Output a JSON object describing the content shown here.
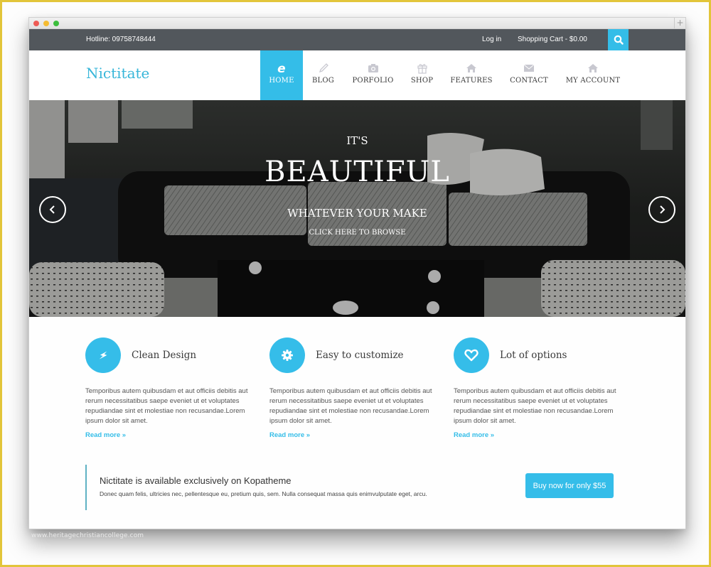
{
  "window": {
    "controls": [
      "close",
      "minimize",
      "maximize"
    ],
    "new_tab_label": "+"
  },
  "topbar": {
    "hotline": "Hotline: 09758748444",
    "login": "Log in",
    "cart": "Shopping Cart - $0.00",
    "search_icon": "search-icon"
  },
  "header": {
    "logo": "Nictitate",
    "nav": [
      {
        "label": "HOME",
        "icon": "ie-icon",
        "active": true
      },
      {
        "label": "BLOG",
        "icon": "pencil-icon",
        "active": false
      },
      {
        "label": "PORFOLIO",
        "icon": "camera-icon",
        "active": false
      },
      {
        "label": "SHOP",
        "icon": "gift-icon",
        "active": false
      },
      {
        "label": "FEATURES",
        "icon": "home-icon",
        "active": false
      },
      {
        "label": "CONTACT",
        "icon": "envelope-icon",
        "active": false
      },
      {
        "label": "MY ACCOUNT",
        "icon": "home-icon",
        "active": false
      }
    ]
  },
  "hero": {
    "line1": "IT'S",
    "line2": "BEAUTIFUL",
    "line3": "WHATEVER YOUR MAKE",
    "cta": "CLICK HERE TO BROWSE",
    "prev": "‹",
    "next": "›"
  },
  "features": [
    {
      "icon": "lightning-icon",
      "title": "Clean Design",
      "body": "Temporibus autem quibusdam et aut officiis debitis aut rerum necessitatibus saepe eveniet ut et voluptates repudiandae sint et molestiae non recusandae.Lorem ipsum dolor sit amet.",
      "link": "Read more »"
    },
    {
      "icon": "gear-icon",
      "title": "Easy to customize",
      "body": "Temporibus autem quibusdam et aut officiis debitis aut rerum necessitatibus saepe eveniet ut et voluptates repudiandae sint et molestiae non recusandae.Lorem ipsum dolor sit amet.",
      "link": "Read more »"
    },
    {
      "icon": "heart-icon",
      "title": "Lot of options",
      "body": "Temporibus autem quibusdam et aut officiis debitis aut rerum necessitatibus saepe eveniet ut et voluptates repudiandae sint et molestiae non recusandae.Lorem ipsum dolor sit amet.",
      "link": "Read more »"
    }
  ],
  "promo": {
    "title": "Nictitate is available exclusively on Kopatheme",
    "body": "Donec quam felis, ultricies nec, pellentesque eu, pretium quis, sem. Nulla consequat massa quis enimvulputate eget, arcu.",
    "button": "Buy now for only $55"
  },
  "watermark": "www.heritagechristiancollege.com",
  "colors": {
    "accent": "#35bde9",
    "topbar": "#52575c",
    "logo": "#37b6d9",
    "frame": "#e2c53a"
  }
}
